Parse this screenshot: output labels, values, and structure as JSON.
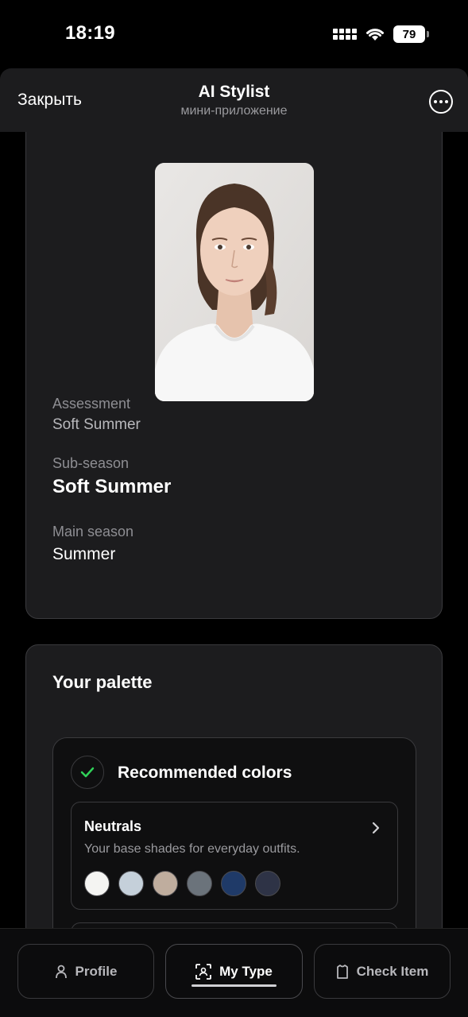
{
  "status_bar": {
    "time": "18:19",
    "battery": "79"
  },
  "header": {
    "close_label": "Закрыть",
    "title": "AI Stylist",
    "subtitle": "мини-приложение"
  },
  "assessment": {
    "assessment_label": "Assessment",
    "assessment_value": "Soft Summer",
    "subseason_label": "Sub-season",
    "subseason_value": "Soft Summer",
    "main_season_label": "Main season",
    "main_season_value": "Summer"
  },
  "palette": {
    "title": "Your palette",
    "recommended_title": "Recommended colors",
    "neutrals": {
      "title": "Neutrals",
      "description": "Your base shades for everyday outfits.",
      "swatches": [
        "#f4f4f2",
        "#c5d0da",
        "#bfad9e",
        "#6b737b",
        "#1f3a68",
        "#2e3346"
      ]
    }
  },
  "bottom_nav": {
    "profile": "Profile",
    "my_type": "My Type",
    "check_item": "Check Item"
  },
  "colors": {
    "background": "#000000",
    "card": "#1c1c1e",
    "border": "#3a3a3d",
    "check": "#30d158"
  }
}
